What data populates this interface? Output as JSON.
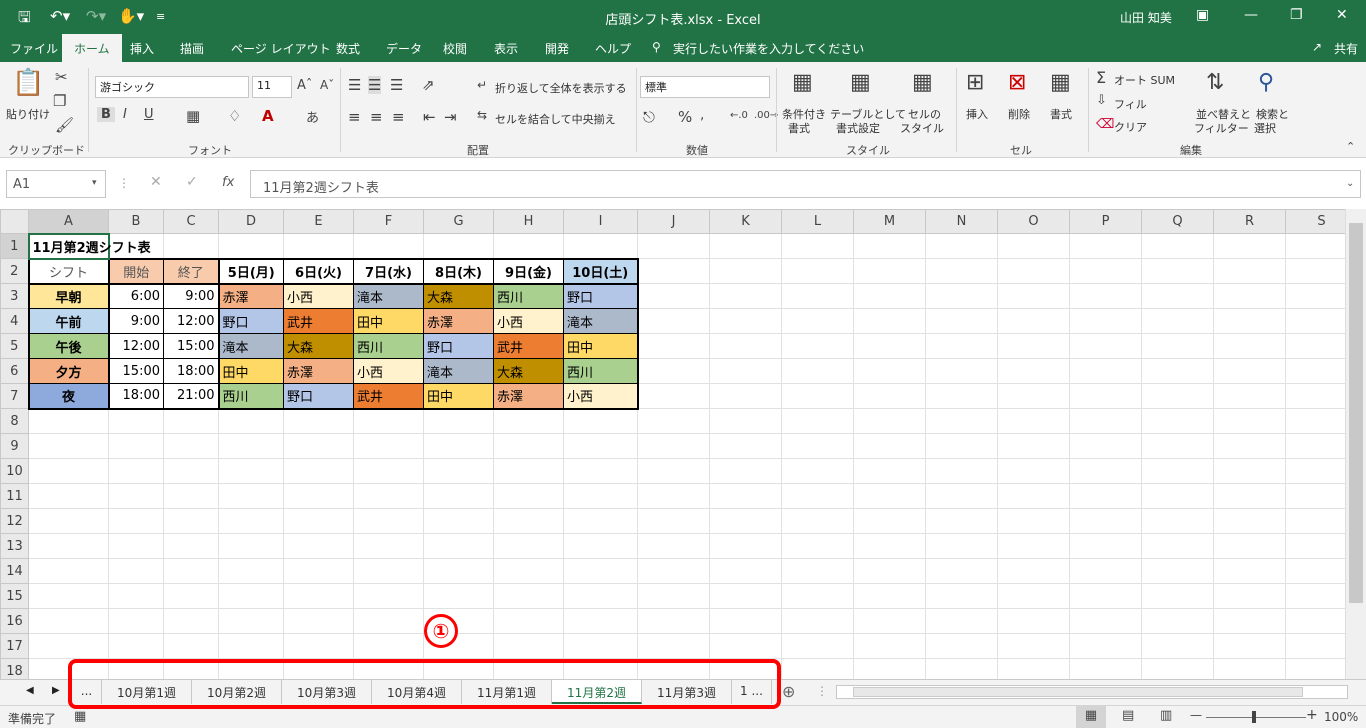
{
  "window": {
    "title": "店頭シフト表.xlsx  -  Excel",
    "user": "山田 知美",
    "share": "共有"
  },
  "ribbon_tabs": [
    "ファイル",
    "ホーム",
    "挿入",
    "描画",
    "ページ レイアウト",
    "数式",
    "データ",
    "校閲",
    "表示",
    "開発",
    "ヘルプ"
  ],
  "active_tab": "ホーム",
  "tell_me": "実行したい作業を入力してください",
  "clipboard": {
    "paste": "貼り付け",
    "label": "クリップボード"
  },
  "font": {
    "name": "游ゴシック",
    "size": "11",
    "label": "フォント"
  },
  "alignment": {
    "wrap": "折り返して全体を表示する",
    "merge": "セルを結合して中央揃え",
    "label": "配置"
  },
  "number": {
    "format": "標準",
    "label": "数値"
  },
  "styles": {
    "cond1": "条件付き",
    "cond2": "書式",
    "table1": "テーブルとして",
    "table2": "書式設定",
    "cell1": "セルの",
    "cell2": "スタイル",
    "label": "スタイル"
  },
  "cells": {
    "insert": "挿入",
    "delete": "削除",
    "format": "書式",
    "label": "セル"
  },
  "editing": {
    "autosum": "オート SUM",
    "fill": "フィル",
    "clear": "クリア",
    "sort1": "並べ替えと",
    "sort2": "フィルター",
    "find1": "検索と",
    "find2": "選択",
    "label": "編集"
  },
  "formula_bar": {
    "name_box": "A1",
    "content": "11月第2週シフト表"
  },
  "columns": [
    "A",
    "B",
    "C",
    "D",
    "E",
    "F",
    "G",
    "H",
    "I",
    "J",
    "K",
    "L",
    "M",
    "N",
    "O",
    "P",
    "Q",
    "R",
    "S"
  ],
  "rows": [
    [
      "11月第2週シフト表",
      "",
      "",
      "",
      "",
      "",
      "",
      "",
      ""
    ],
    [
      "シフト",
      "開始",
      "終了",
      "5日(月)",
      "6日(火)",
      "7日(水)",
      "8日(木)",
      "9日(金)",
      "10日(土)"
    ],
    [
      "早朝",
      "6:00",
      "9:00",
      "赤澤",
      "小西",
      "滝本",
      "大森",
      "西川",
      "野口"
    ],
    [
      "午前",
      "9:00",
      "12:00",
      "野口",
      "武井",
      "田中",
      "赤澤",
      "小西",
      "滝本"
    ],
    [
      "午後",
      "12:00",
      "15:00",
      "滝本",
      "大森",
      "西川",
      "野口",
      "武井",
      "田中"
    ],
    [
      "夕方",
      "15:00",
      "18:00",
      "田中",
      "赤澤",
      "小西",
      "滝本",
      "大森",
      "西川"
    ],
    [
      "夜",
      "18:00",
      "21:00",
      "西川",
      "野口",
      "武井",
      "田中",
      "赤澤",
      "小西"
    ]
  ],
  "row_numbers": [
    "1",
    "2",
    "3",
    "4",
    "5",
    "6",
    "7",
    "8",
    "9",
    "10",
    "11",
    "12",
    "13",
    "14",
    "15",
    "16",
    "17",
    "18"
  ],
  "shift_colors": {
    "早朝": "#ffe699",
    "午前": "#bdd7ee",
    "午後": "#a9d08e",
    "夕方": "#f4b084",
    "夜": "#8ea9db"
  },
  "name_colors": {
    "赤澤": "#f4b084",
    "小西": "#fff2cc",
    "滝本": "#acb9ca",
    "大森": "#bf8f00",
    "西川": "#a9d08e",
    "野口": "#b4c6e7",
    "武井": "#ed7d31",
    "田中": "#ffd966"
  },
  "sheet_tabs": [
    "...",
    "10月第1週",
    "10月第2週",
    "10月第3週",
    "10月第4週",
    "11月第1週",
    "11月第2週",
    "11月第3週",
    "1 ..."
  ],
  "active_sheet": "11月第2週",
  "annotation": "①",
  "status": {
    "ready": "準備完了",
    "zoom": "100%"
  }
}
